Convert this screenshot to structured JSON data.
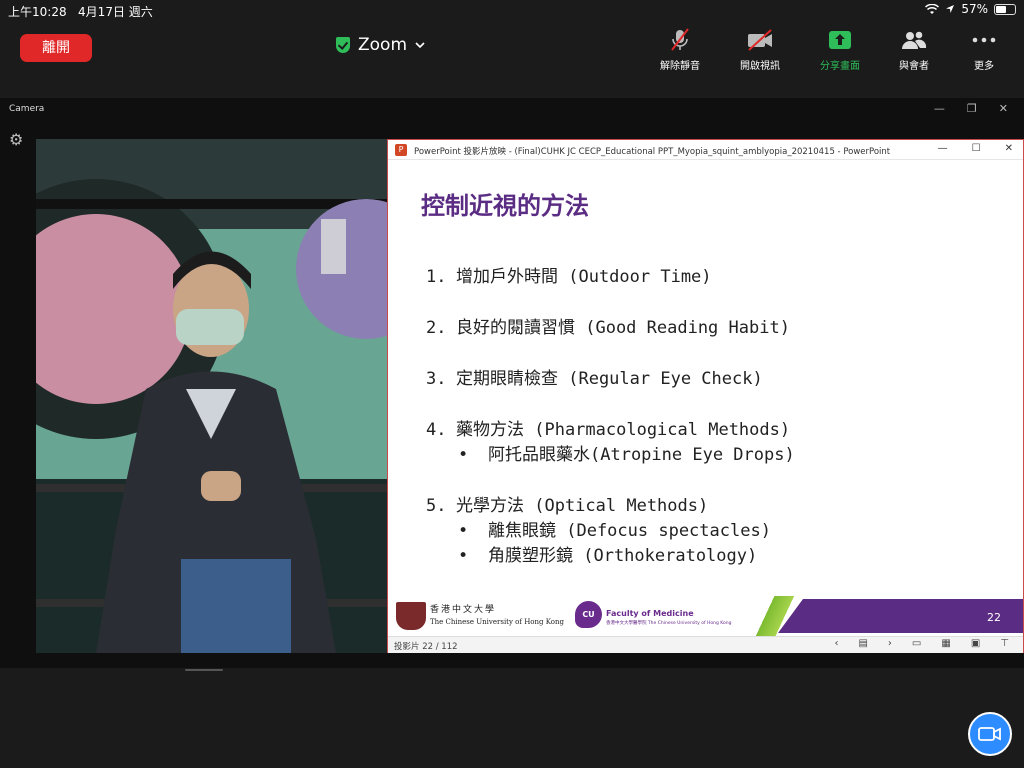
{
  "status_bar": {
    "time": "上午10:28",
    "date": "4月17日 週六",
    "battery_percent": "57%",
    "battery_level": 0.57
  },
  "top_bar": {
    "leave_label": "離開",
    "meeting_title": "Zoom",
    "tools": {
      "mute": "解除靜音",
      "video": "開啟視訊",
      "share": "分享畫面",
      "participants": "與會者",
      "more": "更多"
    }
  },
  "camera_window": {
    "title": "Camera"
  },
  "powerpoint": {
    "window_title": "PowerPoint 投影片放映 - (Final)CUHK JC CECP_Educational PPT_Myopia_squint_amblyopia_20210415 - PowerPoint",
    "slide": {
      "title": "控制近視的方法",
      "items": [
        {
          "num": "1.",
          "text": "增加戶外時間 (Outdoor Time)",
          "subitems": []
        },
        {
          "num": "2.",
          "text": "良好的閱讀習慣 (Good Reading Habit)",
          "subitems": []
        },
        {
          "num": "3.",
          "text": "定期眼睛檢查 (Regular Eye Check)",
          "subitems": []
        },
        {
          "num": "4.",
          "text": "藥物方法 (Pharmacological Methods)",
          "subitems": [
            "阿托品眼藥水(Atropine Eye Drops)"
          ]
        },
        {
          "num": "5.",
          "text": "光學方法 (Optical Methods)",
          "subitems": [
            "離焦眼鏡 (Defocus spectacles)",
            "角膜塑形鏡 (Orthokeratology)"
          ]
        }
      ],
      "footer": {
        "cuhk_name_zh": "香港中文大學",
        "cuhk_name_en": "The Chinese University of Hong Kong",
        "cu_logo": "CU",
        "faculty_name": "Faculty of Medicine",
        "faculty_sub": "香港中文大學醫學院 The Chinese University of Hong Kong",
        "slide_number": "22"
      }
    },
    "status": {
      "slide_counter": "投影片 22 / 112"
    }
  },
  "colors": {
    "leave_red": "#e02828",
    "share_green": "#2ebd59",
    "slide_title_purple": "#5b2c83",
    "fab_blue": "#2d8cff"
  }
}
